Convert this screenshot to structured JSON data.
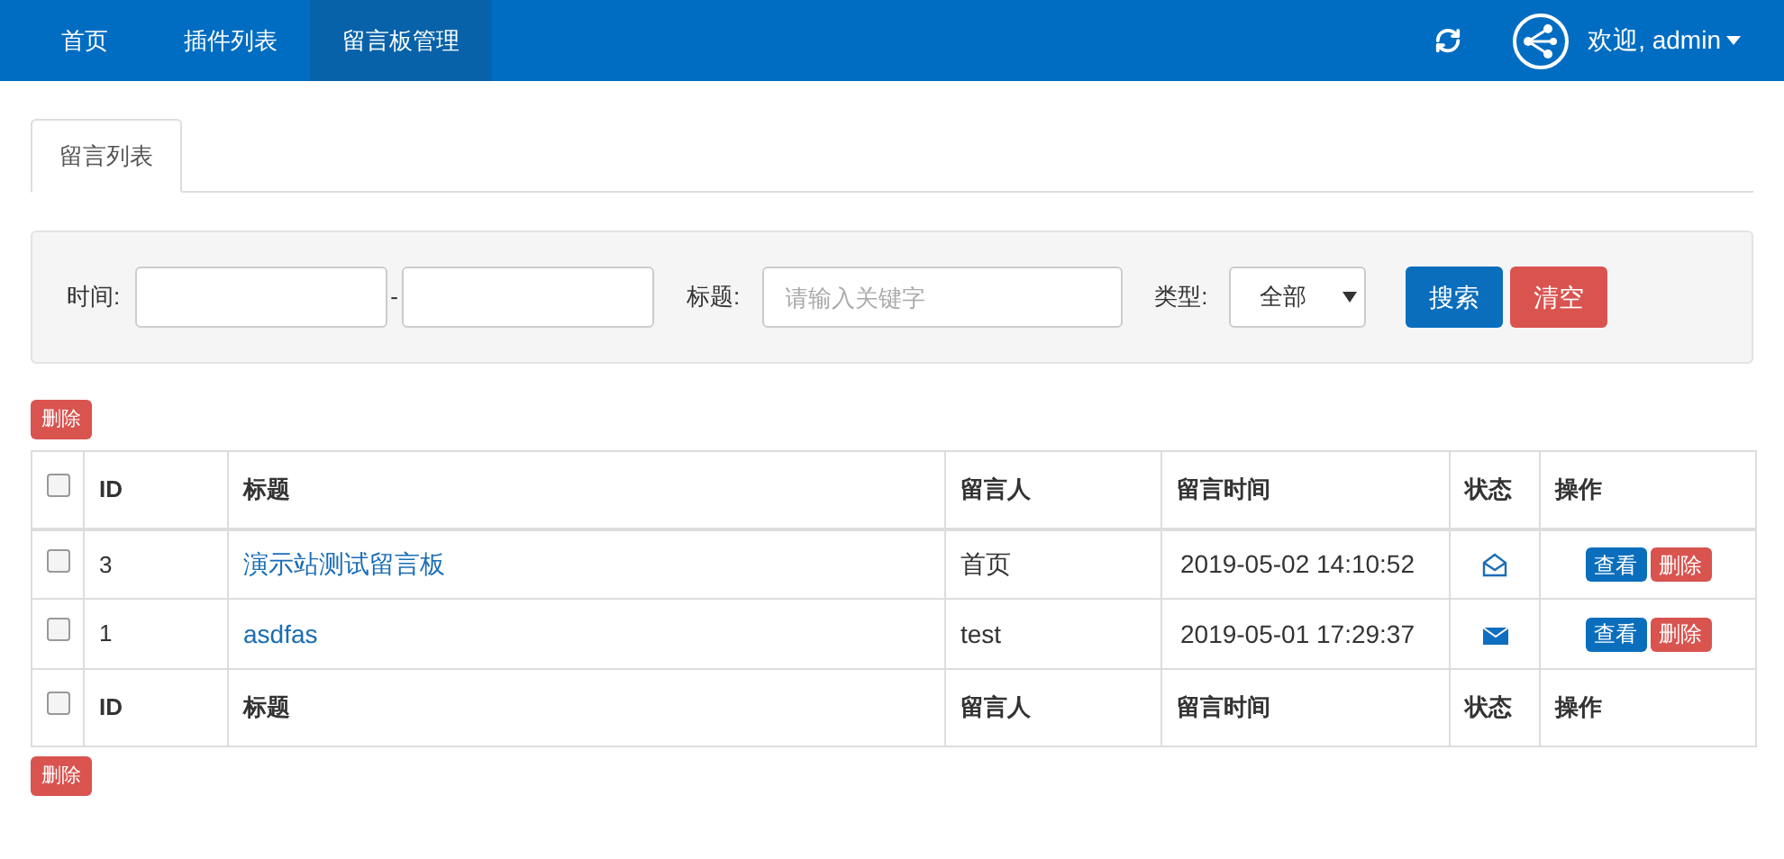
{
  "nav": {
    "items": [
      {
        "label": "首页",
        "selected": false
      },
      {
        "label": "插件列表",
        "selected": false
      },
      {
        "label": "留言板管理",
        "selected": true
      }
    ],
    "user": "欢迎, admin"
  },
  "tabs": [
    {
      "label": "留言列表",
      "selected": true
    }
  ],
  "filter": {
    "time_label": "时间:",
    "separator": "-",
    "title_label": "标题:",
    "title_placeholder": "请输入关键字",
    "type_label": "类型:",
    "type_value": "全部",
    "search_button": "搜索",
    "clear_button": "清空"
  },
  "delete_button_top": "删除",
  "table": {
    "columns": [
      "ID",
      "标题",
      "留言人",
      "留言时间",
      "状态",
      "操作"
    ],
    "rows": [
      {
        "id": "3",
        "title": "演示站测试留言板",
        "author": "首页",
        "time": "2019-05-02 14:10:52",
        "read": true,
        "checked": false,
        "actions": [
          "查看",
          "删除"
        ]
      },
      {
        "id": "1",
        "title": "asdfas",
        "author": "test",
        "time": "2019-05-01 17:29:37",
        "read": false,
        "checked": false,
        "actions": [
          "查看",
          "删除"
        ]
      }
    ],
    "footer_columns": [
      "ID",
      "标题",
      "留言人",
      "留言时间",
      "状态",
      "操作"
    ],
    "header_checked": false,
    "footer_checked": false
  },
  "delete_button_bottom": "删除"
}
